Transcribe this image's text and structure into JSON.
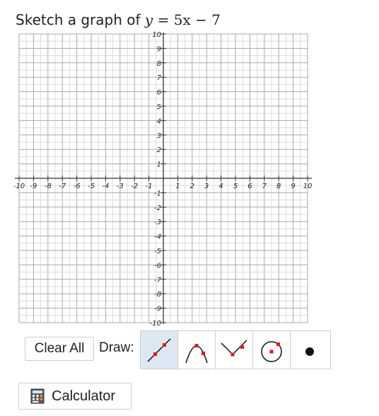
{
  "prompt": {
    "text": "Sketch a graph of",
    "equation_lhs": "y",
    "equation_eq": "=",
    "equation_rhs": "5x − 7"
  },
  "graph": {
    "x_range": [
      -10,
      10
    ],
    "y_range": [
      -10,
      10
    ],
    "minor_step": 0.5,
    "major_step": 1,
    "x_tick_labels": [
      "-10",
      "-9",
      "-8",
      "-7",
      "-6",
      "-5",
      "-4",
      "-3",
      "-2",
      "-1",
      "1",
      "2",
      "3",
      "4",
      "5",
      "6",
      "7",
      "8",
      "9",
      "10"
    ],
    "y_tick_labels": [
      "10",
      "9",
      "8",
      "7",
      "6",
      "5",
      "4",
      "3",
      "2",
      "1",
      "-1",
      "-2",
      "-3",
      "-4",
      "-5",
      "-6",
      "-7",
      "-8",
      "-9",
      "-10"
    ],
    "colors": {
      "minor_grid": "#dcdcdc",
      "major_grid": "#a9a9a9",
      "axis": "#333333"
    }
  },
  "controls": {
    "clear_all": "Clear All",
    "draw_label": "Draw:",
    "tools": [
      {
        "name": "line",
        "icon": "line-tool-icon",
        "active": true
      },
      {
        "name": "parabola",
        "icon": "parabola-tool-icon",
        "active": false
      },
      {
        "name": "absolute-value",
        "icon": "absolute-value-tool-icon",
        "active": false
      },
      {
        "name": "circle",
        "icon": "circle-tool-icon",
        "active": false
      },
      {
        "name": "point",
        "icon": "point-tool-icon",
        "active": false
      }
    ],
    "calculator": "Calculator"
  }
}
